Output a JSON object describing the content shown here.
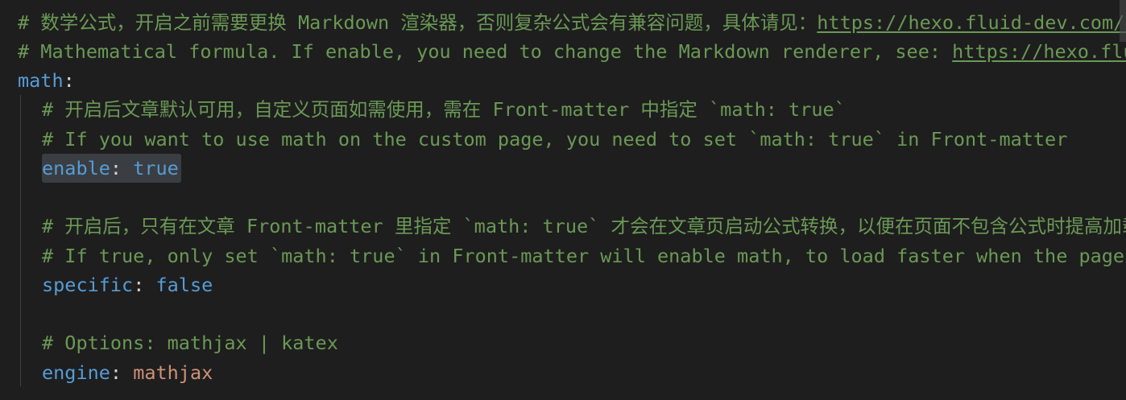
{
  "lines": {
    "l1_comment": "# 数学公式，开启之前需要更换 Markdown 渲染器，否则复杂公式会有兼容问题，具体请见：",
    "l1_link": "https://hexo.fluid-dev.com/docs/guide/##latex-数学公式",
    "l2_comment": "# Mathematical formula. If enable, you need to change the Markdown renderer, see: ",
    "l2_link": "https://hexo.fluid-dev.com/docs/en/guide/#latex",
    "l3_key": "math",
    "l3_colon": ":",
    "l4_comment": "# 开启后文章默认可用，自定义页面如需使用，需在 Front-matter 中指定 `math: true`",
    "l5_comment": "# If you want to use math on the custom page, you need to set `math: true` in Front-matter",
    "l6_key": "enable",
    "l6_colon": ":",
    "l6_value": "true",
    "l8_comment": "# 开启后，只有在文章 Front-matter 里指定 `math: true` 才会在文章页启动公式转换，以便在页面不包含公式时提高加载速度",
    "l9_comment": "# If true, only set `math: true` in Front-matter will enable math, to load faster when the page does not contain math",
    "l10_key": "specific",
    "l10_colon": ":",
    "l10_value": "false",
    "l12_comment": "# Options: mathjax | katex",
    "l13_key": "engine",
    "l13_colon": ":",
    "l13_value": "mathjax"
  },
  "colors": {
    "background": "#1e1e1e",
    "comment": "#6a9955",
    "key": "#569cd6",
    "string": "#ce9178",
    "text": "#d4d4d4"
  }
}
